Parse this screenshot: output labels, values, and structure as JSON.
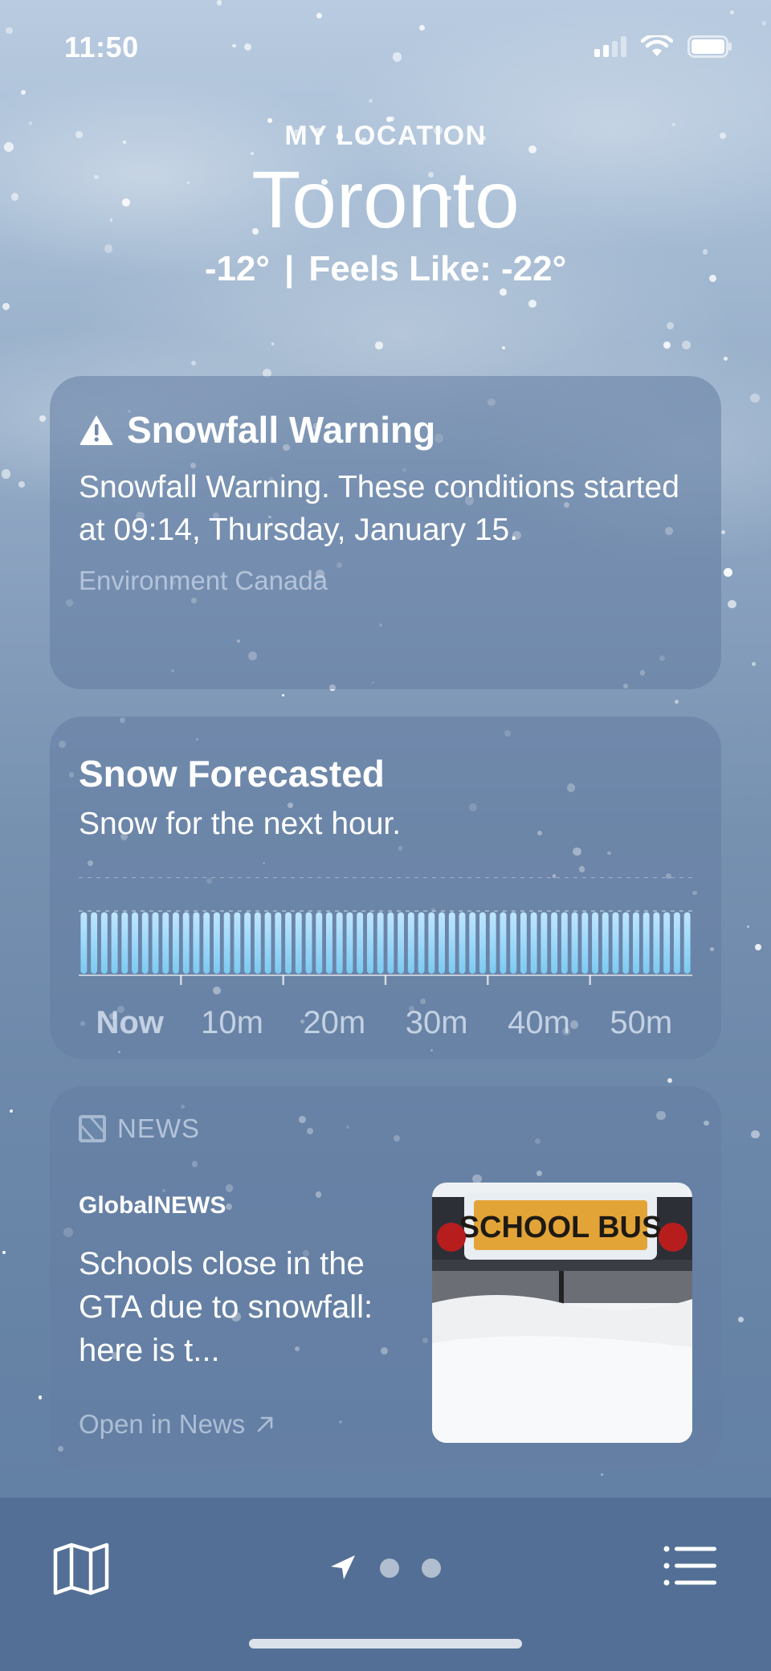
{
  "status_bar": {
    "time": "11:50"
  },
  "header": {
    "location_label": "MY LOCATION",
    "city": "Toronto",
    "temperature": "-12°",
    "separator": "|",
    "feels_like": "Feels Like: -22°"
  },
  "warning": {
    "title": "Snowfall Warning",
    "body": "Snowfall Warning. These conditions started at 09:14, Thursday, January 15.",
    "source": "Environment Canada"
  },
  "forecast": {
    "title": "Snow Forecasted",
    "subtitle": "Snow for the next hour."
  },
  "chart_data": {
    "type": "bar",
    "categories": [
      "Now",
      "10m",
      "20m",
      "30m",
      "40m",
      "50m"
    ],
    "bar_count": 60,
    "intensity": 0.85,
    "colors": {
      "bar_top": "#bfe6ff",
      "bar_bottom": "#7ccaf2"
    }
  },
  "news": {
    "label": "NEWS",
    "publisher": "GlobalNEWS",
    "headline": "Schools close in the GTA due to snowfall: here is t...",
    "open_label": "Open in News",
    "image_text": "SCHOOL BUS"
  },
  "tabbar": {
    "icons": [
      "map-icon",
      "location-arrow-icon",
      "page-dot",
      "page-dot",
      "list-icon"
    ]
  },
  "colors": {
    "accent": "#ffffff",
    "muted": "#c9d8ea"
  }
}
